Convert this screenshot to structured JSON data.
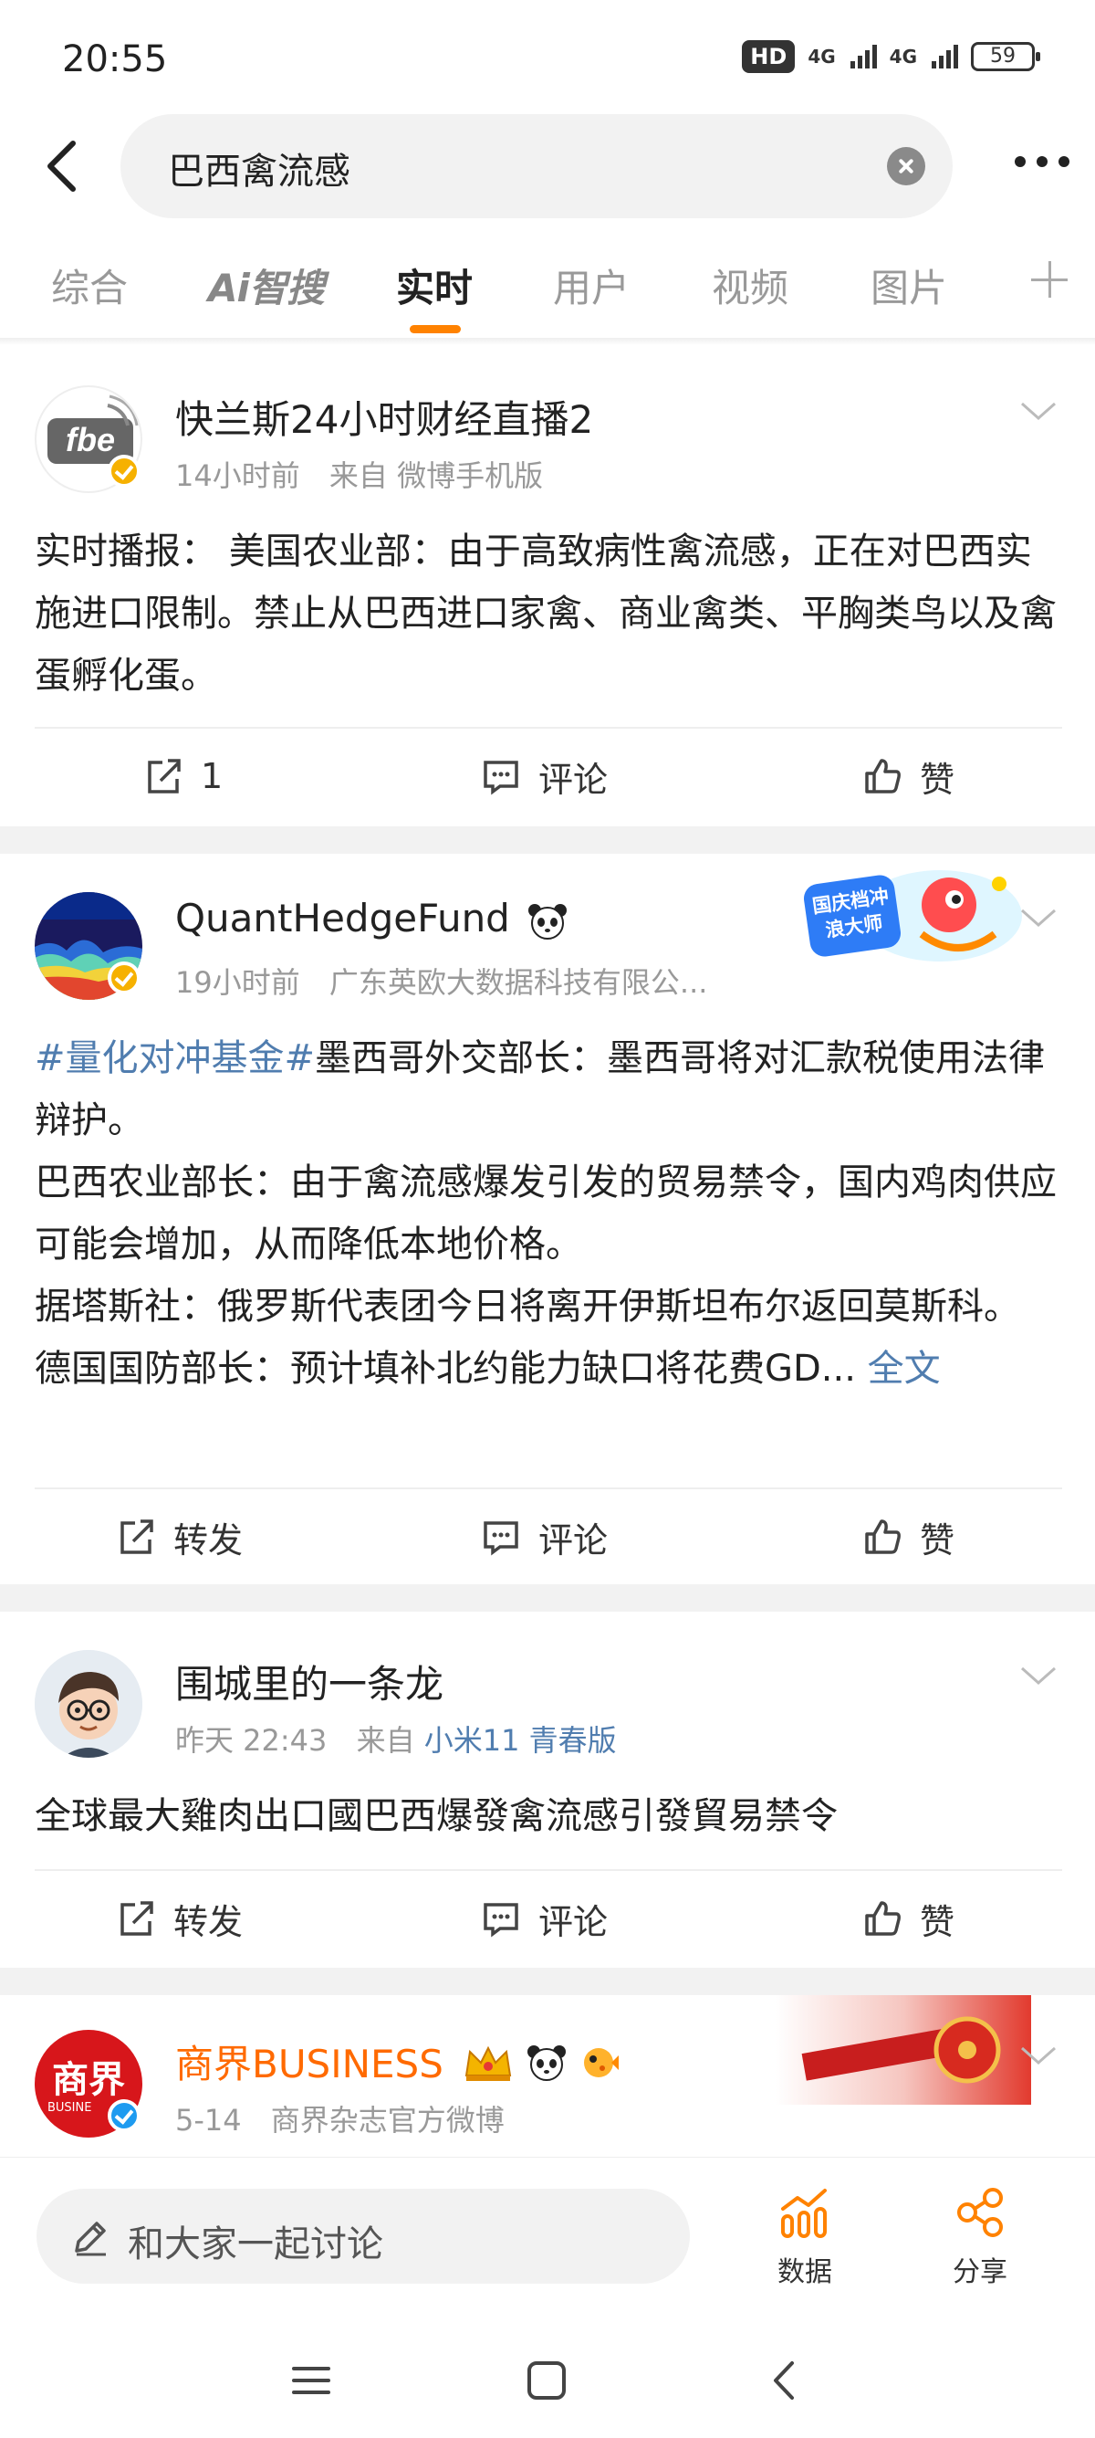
{
  "status_bar": {
    "time": "20:55",
    "hd": "HD",
    "net1": "4G",
    "net2": "4G",
    "battery": "59"
  },
  "header": {
    "search_query": "巴西禽流感"
  },
  "tabs": [
    {
      "label": "综合"
    },
    {
      "label": "Ai智搜"
    },
    {
      "label": "实时",
      "active": true
    },
    {
      "label": "用户"
    },
    {
      "label": "视频"
    },
    {
      "label": "图片"
    }
  ],
  "posts": [
    {
      "username": "快兰斯24小时财经直播2",
      "time": "14小时前",
      "source_prefix": "来自",
      "source": "微博手机版",
      "content": "实时播报： 美国农业部：由于高致病性禽流感，正在对巴西实施进口限制。禁止从巴西进口家禽、商业禽类、平胸类鸟以及禽蛋孵化蛋。",
      "avatar_text": "fbe",
      "actions": {
        "repost": "1",
        "comment": "评论",
        "like": "赞"
      }
    },
    {
      "username": "QuantHedgeFund",
      "time": "19小时前",
      "source": "广东英欧大数据科技有限公...",
      "hashtag": "#量化对冲基金#",
      "content_lines": [
        "墨西哥外交部长：墨西哥将对汇款税使用法律辩护。",
        "巴西农业部长：由于禽流感爆发引发的贸易禁令，国内鸡肉供应可能会增加，从而降低本地价格。",
        "据塔斯社：俄罗斯代表团今日将离开伊斯坦布尔返回莫斯科。",
        "德国国防部长：预计填补北约能力缺口将花费GD..."
      ],
      "full_text": "全文",
      "badge_text": "国庆档冲浪大师",
      "actions": {
        "repost": "转发",
        "comment": "评论",
        "like": "赞"
      }
    },
    {
      "username": "围城里的一条龙",
      "time": "昨天 22:43",
      "source_prefix": "来自",
      "source": "小米11 青春版",
      "content": "全球最大雞肉出口國巴西爆發禽流感引發貿易禁令",
      "actions": {
        "repost": "转发",
        "comment": "评论",
        "like": "赞"
      }
    },
    {
      "username": "商界BUSINESS",
      "username_color": "#ff6a00",
      "time": "5-14",
      "source": "商界杂志官方微博",
      "avatar_text": "商界",
      "avatar_sub": "BUSINE"
    }
  ],
  "bottom_bar": {
    "discuss_placeholder": "和大家一起讨论",
    "data_label": "数据",
    "share_label": "分享",
    "accent": "#ff8200"
  }
}
